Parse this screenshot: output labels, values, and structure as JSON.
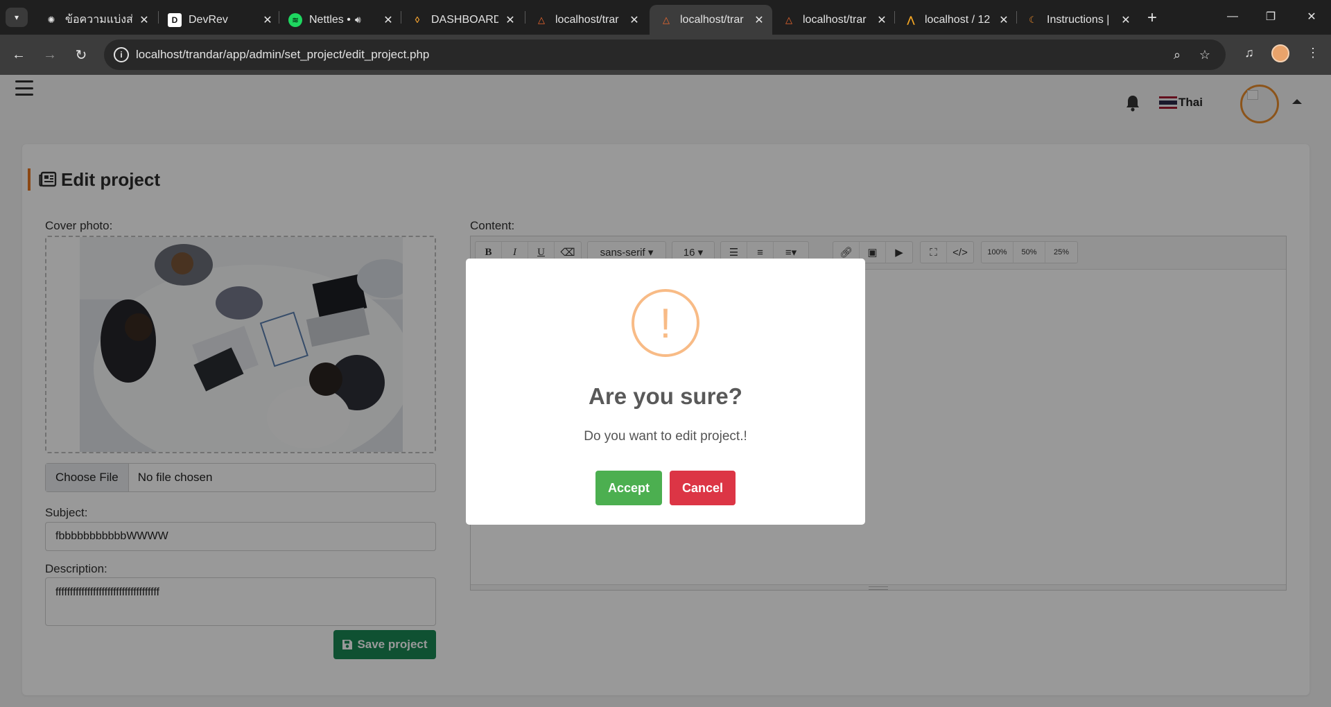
{
  "browser": {
    "tabs": [
      {
        "title": "ข้อความแบ่งส่วน",
        "favicon": "chatgpt-icon",
        "active": false
      },
      {
        "title": "DevRev",
        "favicon": "devrev-icon",
        "active": false
      },
      {
        "title": "Nettles •",
        "favicon": "spotify-icon",
        "active": false,
        "audio": true
      },
      {
        "title": "DASHBOARD",
        "favicon": "dashboard-icon",
        "active": false
      },
      {
        "title": "localhost/trar",
        "favicon": "triangle-icon",
        "active": false
      },
      {
        "title": "localhost/trar",
        "favicon": "triangle-icon",
        "active": true
      },
      {
        "title": "localhost/trar",
        "favicon": "triangle-icon",
        "active": false
      },
      {
        "title": "localhost / 12",
        "favicon": "phpmyadmin-icon",
        "active": false
      },
      {
        "title": "Instructions |",
        "favicon": "instructions-icon",
        "active": false
      }
    ],
    "url": "localhost/trandar/app/admin/set_project/edit_project.php"
  },
  "topnav": {
    "language": "Thai"
  },
  "card": {
    "title": "Edit project",
    "cover_label": "Cover photo:",
    "file_button": "Choose File",
    "file_status": "No file chosen",
    "subject_label": "Subject:",
    "subject_value": "fbbbbbbbbbbbWWWW",
    "description_label": "Description:",
    "description_value": "ffffffffffffffffffffffffffffffffffff",
    "save_label": "Save project",
    "content_label": "Content:"
  },
  "editor": {
    "font_family": "sans-serif",
    "font_size": "16",
    "image_sizes": [
      "100%",
      "50%",
      "25%"
    ]
  },
  "modal": {
    "icon": "!",
    "title": "Are you sure?",
    "text": "Do you want to edit project.!",
    "accept_label": "Accept",
    "cancel_label": "Cancel",
    "accept_color": "#4caf50",
    "cancel_color": "#dc3545"
  }
}
